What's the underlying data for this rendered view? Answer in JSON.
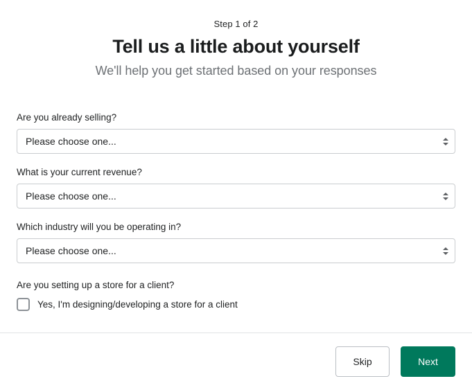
{
  "header": {
    "step_label": "Step 1 of 2",
    "title": "Tell us a little about yourself",
    "subtitle": "We'll help you get started based on your responses"
  },
  "form": {
    "fields": [
      {
        "label": "Are you already selling?",
        "value": "Please choose one...",
        "control": "select",
        "icon": "stepper-arrows-icon"
      },
      {
        "label": "What is your current revenue?",
        "value": "Please choose one...",
        "control": "select",
        "icon": "stepper-arrows-icon"
      },
      {
        "label": "Which industry will you be operating in?",
        "value": "Please choose one...",
        "control": "select",
        "icon": "stepper-arrows-icon"
      }
    ],
    "client_question": {
      "label": "Are you setting up a store for a client?",
      "checkbox_label": "Yes, I'm designing/developing a store for a client",
      "checked": false
    }
  },
  "footer": {
    "skip_label": "Skip",
    "next_label": "Next"
  },
  "colors": {
    "accent_green": "#00795c",
    "text_primary": "#202223",
    "text_subdued": "#6d7175",
    "border": "#c9cccf",
    "divider": "#e1e3e5"
  }
}
